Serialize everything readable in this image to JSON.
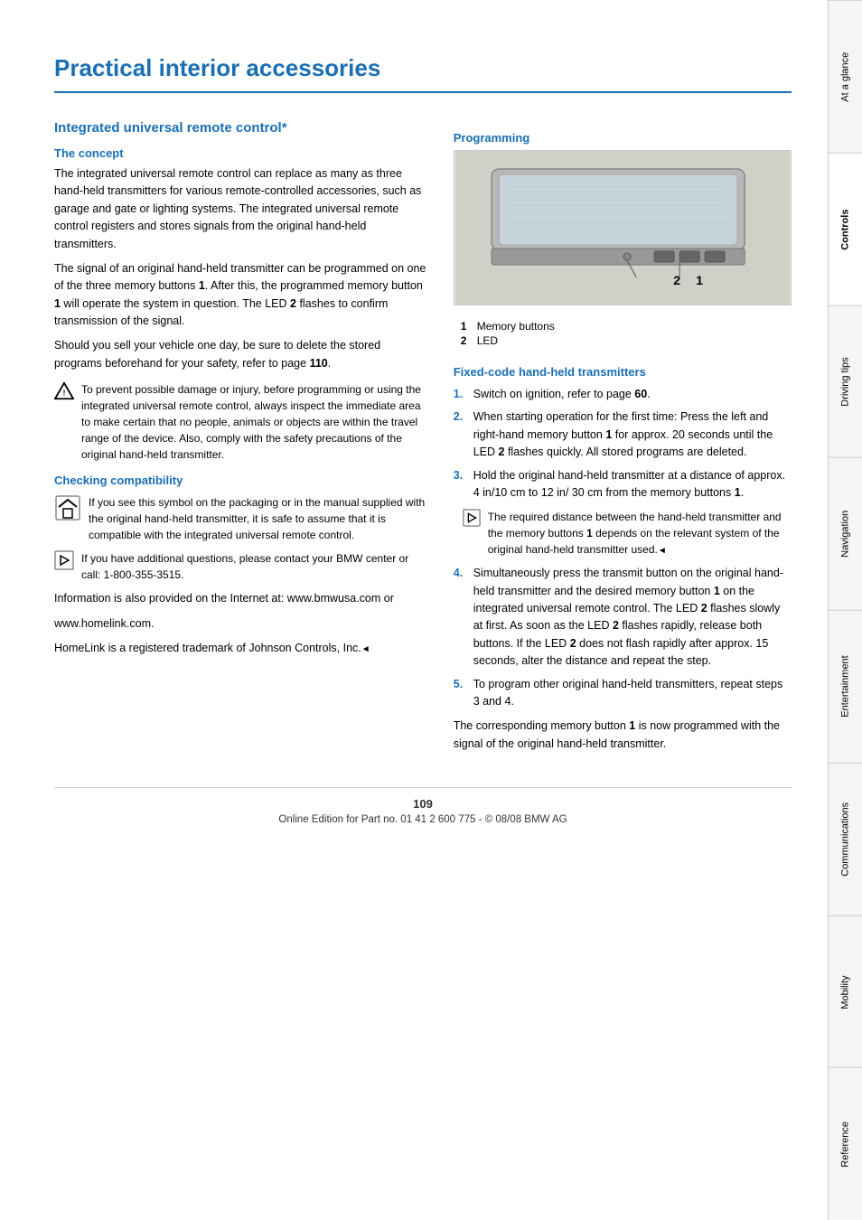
{
  "page": {
    "title": "Practical interior accessories",
    "number": "109",
    "footer": "Online Edition for Part no. 01 41 2 600 775 - © 08/08 BMW AG"
  },
  "sidebar": {
    "tabs": [
      {
        "id": "at-a-glance",
        "label": "At a glance",
        "active": false
      },
      {
        "id": "controls",
        "label": "Controls",
        "active": true
      },
      {
        "id": "driving-tips",
        "label": "Driving tips",
        "active": false
      },
      {
        "id": "navigation",
        "label": "Navigation",
        "active": false
      },
      {
        "id": "entertainment",
        "label": "Entertainment",
        "active": false
      },
      {
        "id": "communications",
        "label": "Communications",
        "active": false
      },
      {
        "id": "mobility",
        "label": "Mobility",
        "active": false
      },
      {
        "id": "reference",
        "label": "Reference",
        "active": false
      }
    ]
  },
  "left": {
    "section_title": "Integrated universal remote control*",
    "concept_heading": "The concept",
    "concept_p1": "The integrated universal remote control can replace as many as three hand-held transmitters for various remote-controlled accessories, such as garage and gate or lighting systems. The integrated universal remote control registers and stores signals from the original hand-held transmitters.",
    "concept_p2": "The signal of an original hand-held transmitter can be programmed on one of the three memory buttons 1. After this, the programmed memory button 1 will operate the system in question. The LED 2 flashes to confirm transmission of the signal.",
    "concept_p3": "Should you sell your vehicle one day, be sure to delete the stored programs beforehand for your safety, refer to page 110.",
    "warning_text": "To prevent possible damage or injury, before programming or using the integrated universal remote control, always inspect the immediate area to make certain that no people, animals or objects are within the travel range of the device. Also, comply with the safety precautions of the original hand-held transmitter.",
    "checking_heading": "Checking compatibility",
    "checking_info1": "If you see this symbol on the packaging or in the manual supplied with the original hand-held transmitter, it is safe to assume that it is compatible with the integrated universal remote control.",
    "checking_info2": "If you have additional questions, please contact your BMW center or call: 1-800-355-3515.",
    "checking_p1": "Information is also provided on the Internet at: www.bmwusa.com or",
    "checking_p2": "www.homelink.com.",
    "checking_p3": "HomeLink is a registered trademark of Johnson Controls, Inc."
  },
  "right": {
    "programming_heading": "Programming",
    "image_label1_num": "1",
    "image_label1_text": "Memory buttons",
    "image_label2_num": "2",
    "image_label2_text": "LED",
    "fixed_heading": "Fixed-code hand-held transmitters",
    "steps": [
      {
        "num": "1.",
        "text": "Switch on ignition, refer to page 60."
      },
      {
        "num": "2.",
        "text": "When starting operation for the first time: Press the left and right-hand memory button 1 for approx. 20 seconds until the LED 2 flashes quickly. All stored programs are deleted."
      },
      {
        "num": "3.",
        "text": "Hold the original hand-held transmitter at a distance of approx. 4 in/10 cm to 12 in/ 30 cm from the memory buttons 1."
      },
      {
        "num": "4.",
        "text": "Simultaneously press the transmit button on the original hand-held transmitter and the desired memory button 1 on the integrated universal remote control. The LED 2 flashes slowly at first. As soon as the LED 2 flashes rapidly, release both buttons. If the LED 2 does not flash rapidly after approx. 15 seconds, alter the distance and repeat the step."
      },
      {
        "num": "5.",
        "text": "To program other original hand-held transmitters, repeat steps 3 and 4."
      }
    ],
    "step3_note": "The required distance between the hand-held transmitter and the memory buttons 1 depends on the relevant system of the original hand-held transmitter used.",
    "conclusion": "The corresponding memory button 1 is now programmed with the signal of the original hand-held transmitter."
  }
}
